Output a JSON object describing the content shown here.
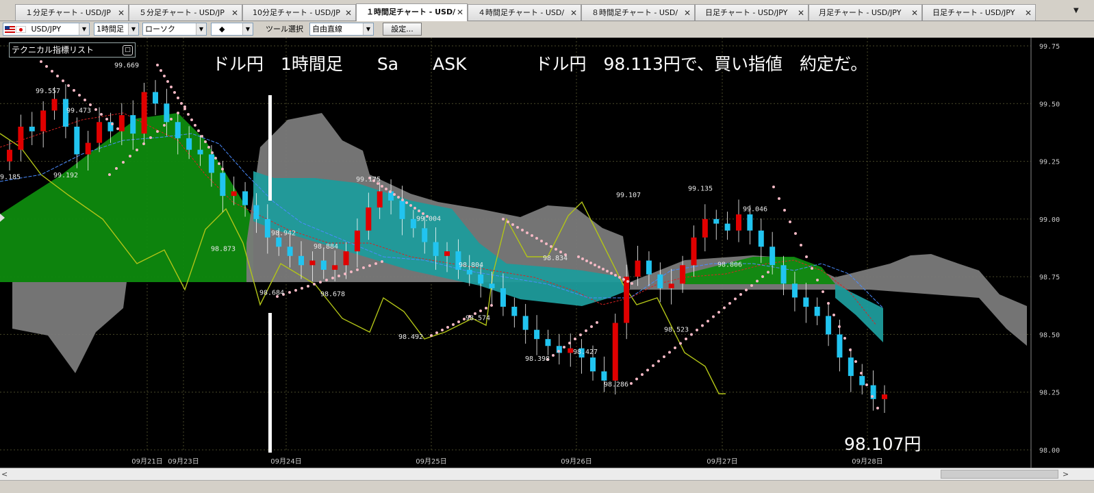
{
  "tabs": [
    {
      "label": "１分足チャート - USD/JP",
      "close": "✕"
    },
    {
      "label": "５分足チャート - USD/JP",
      "close": "✕"
    },
    {
      "label": "10分足チャート - USD/JP",
      "close": "✕"
    },
    {
      "label": "１時間足チャート - USD/",
      "close": "✕"
    },
    {
      "label": "４時間足チャート - USD/",
      "close": "✕"
    },
    {
      "label": "８時間足チャート - USD/",
      "close": "✕"
    },
    {
      "label": "日足チャート - USD/JPY",
      "close": "✕"
    },
    {
      "label": "月足チャート - USD/JPY",
      "close": "✕"
    },
    {
      "label": "日足チャート - USD/JPY",
      "close": "✕"
    }
  ],
  "tab_strip_menu": "▼",
  "toolbar": {
    "symbol": "USD/JPY",
    "timeframe": "1時間足",
    "chart_type": "ローソク",
    "candle_style": "◆",
    "tool_label": "ツール選択",
    "tool_value": "自由直線",
    "settings_button": "設定..."
  },
  "indicator_list": {
    "label": "テクニカル指標リスト",
    "icon": "maximize-icon"
  },
  "annotations": {
    "headline": "ドル円　1時間足　　Sa　　ASK　　　　ドル円　98.113円で、買い指値　約定だ。",
    "footer_price": "98.107円"
  },
  "colors": {
    "background": "#000000",
    "bull": "#e00000",
    "bear": "#21c4f0",
    "kumo_bull": "#0e8a0e",
    "kumo_bear": "#1e9b9b",
    "kumo_gray": "#7a7a7a",
    "chikou": "#b2c417",
    "sar": "#f4b8c4"
  },
  "chart_data": {
    "type": "candlestick",
    "symbol": "USD/JPY",
    "timeframe": "1時間足",
    "y_axis": {
      "min": 98.0,
      "max": 99.75,
      "ticks": [
        "99.75",
        "99.50",
        "99.25",
        "99.00",
        "98.75",
        "98.50",
        "98.25",
        "98.00"
      ]
    },
    "x_ticks": [
      "09月21日",
      "09月23日",
      "09月24日",
      "09月25日",
      "09月26日",
      "09月27日",
      "09月28日"
    ],
    "price_labels": [
      {
        "text": "99.557",
        "value": 99.557
      },
      {
        "text": "99.669",
        "value": 99.669
      },
      {
        "text": "99.473",
        "value": 99.473
      },
      {
        "text": "99.192",
        "value": 99.192
      },
      {
        "text": "99.185",
        "value": 99.185
      },
      {
        "text": "99.175",
        "value": 99.175
      },
      {
        "text": "98.942",
        "value": 98.942
      },
      {
        "text": "98.884",
        "value": 98.884
      },
      {
        "text": "98.873",
        "value": 98.873
      },
      {
        "text": "98.684",
        "value": 98.684
      },
      {
        "text": "98.678",
        "value": 98.678
      },
      {
        "text": "99.004",
        "value": 99.004
      },
      {
        "text": "98.804",
        "value": 98.804
      },
      {
        "text": "98.834",
        "value": 98.834
      },
      {
        "text": "98.492",
        "value": 98.492
      },
      {
        "text": "98.574",
        "value": 98.574
      },
      {
        "text": "98.398",
        "value": 98.398
      },
      {
        "text": "98.427",
        "value": 98.427
      },
      {
        "text": "98.286",
        "value": 98.286
      },
      {
        "text": "99.107",
        "value": 99.107
      },
      {
        "text": "99.135",
        "value": 99.135
      },
      {
        "text": "99.046",
        "value": 99.046
      },
      {
        "text": "98.806",
        "value": 98.806
      },
      {
        "text": "98.523",
        "value": 98.523
      }
    ],
    "series": [
      {
        "name": "candles_close_approx",
        "values": [
          99.3,
          99.4,
          99.38,
          99.47,
          99.52,
          99.4,
          99.28,
          99.33,
          99.42,
          99.38,
          99.45,
          99.37,
          99.55,
          99.5,
          99.42,
          99.35,
          99.3,
          99.28,
          99.2,
          99.1,
          99.12,
          99.06,
          99.0,
          98.92,
          98.88,
          98.84,
          98.8,
          98.82,
          98.78,
          98.8,
          98.86,
          98.95,
          99.05,
          99.12,
          99.08,
          99.0,
          98.96,
          98.9,
          98.84,
          98.86,
          98.78,
          98.76,
          98.72,
          98.7,
          98.62,
          98.58,
          98.52,
          98.48,
          98.45,
          98.42,
          98.44,
          98.4,
          98.34,
          98.3,
          98.55,
          98.75,
          98.82,
          98.76,
          98.7,
          98.72,
          98.8,
          98.92,
          99.0,
          98.98,
          98.95,
          99.02,
          98.95,
          98.88,
          98.8,
          98.72,
          98.66,
          98.62,
          98.58,
          98.5,
          98.4,
          98.32,
          98.28,
          98.22,
          98.24
        ]
      }
    ]
  }
}
